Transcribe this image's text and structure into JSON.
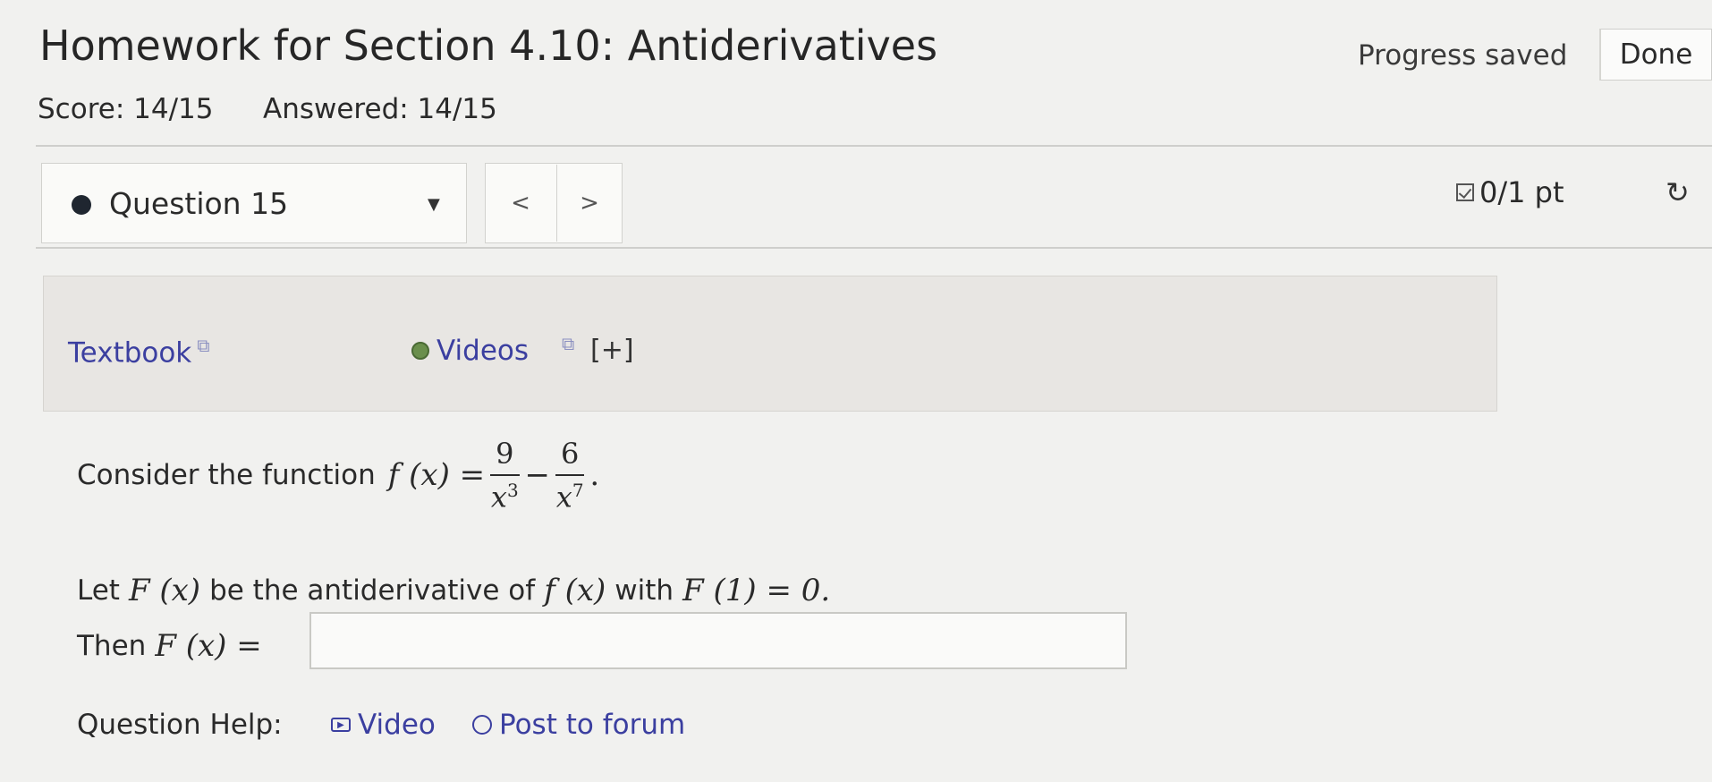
{
  "header": {
    "title": "Homework for Section 4.10: Antiderivatives",
    "progress_status": "Progress saved",
    "done_label": "Done",
    "score": "Score: 14/15",
    "answered": "Answered: 14/15"
  },
  "question_nav": {
    "selected": "Question 15",
    "prev": "<",
    "next": ">",
    "points": "0/1 pt",
    "retry_icon": "↻"
  },
  "resources": {
    "textbook_label": "Textbook",
    "videos_label": "Videos",
    "expand_label": "[+]",
    "external_icon": "⧉"
  },
  "question": {
    "intro": "Consider the function",
    "f_def": "f (x) =",
    "num1": "9",
    "den1": "x",
    "exp1": "3",
    "minus": "−",
    "num2": "6",
    "den2": "x",
    "exp2": "7",
    "period": ".",
    "line2_a": "Let",
    "line2_F": "F (x)",
    "line2_b": "be the antiderivative of",
    "line2_f": "f (x)",
    "line2_c": "with",
    "line2_cond": "F (1) = 0.",
    "line3_a": "Then",
    "line3_F": "F (x) =",
    "answer_value": ""
  },
  "help": {
    "label": "Question Help:",
    "video": "Video",
    "forum": "Post to forum"
  }
}
